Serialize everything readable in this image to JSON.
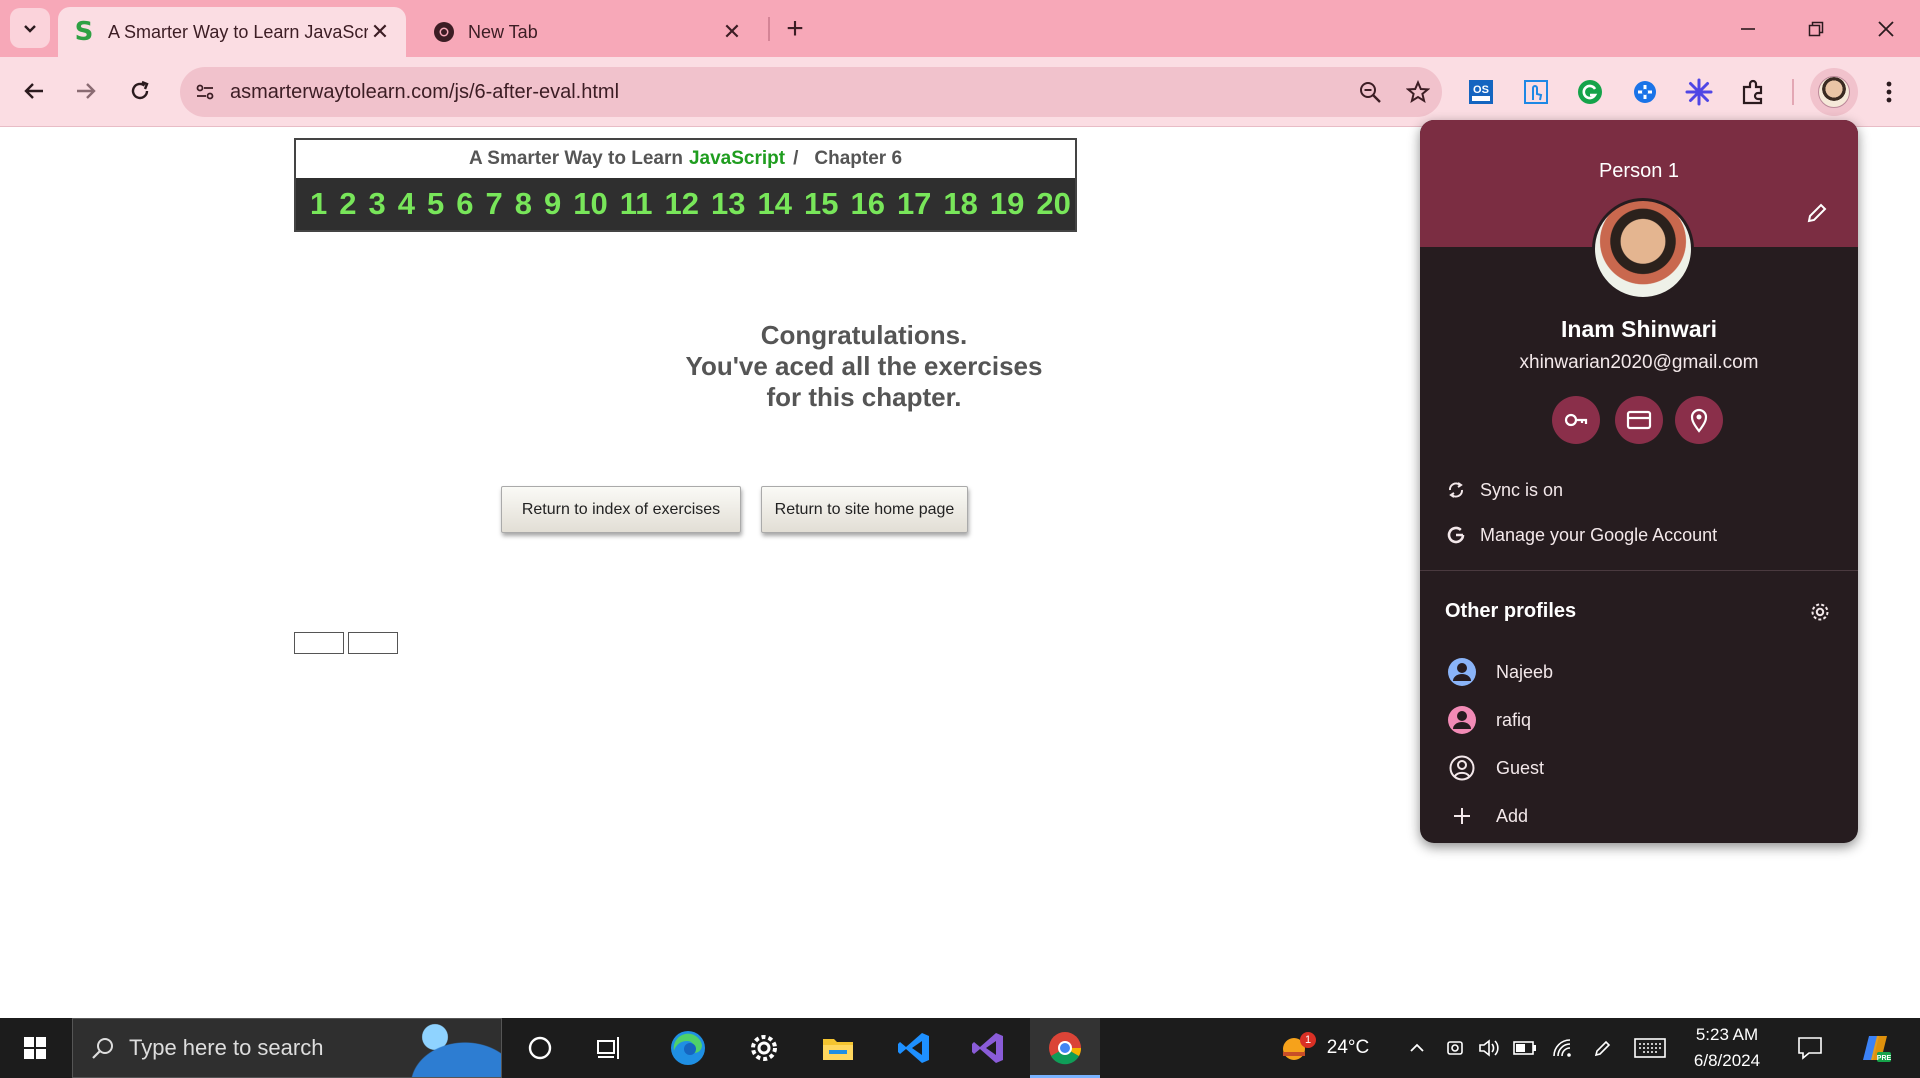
{
  "browser": {
    "tabs": [
      {
        "title": "A Smarter Way to Learn JavaScr",
        "favicon": "S",
        "active": true
      },
      {
        "title": "New Tab",
        "active": false
      }
    ],
    "url": "asmarterwaytolearn.com/js/6-after-eval.html",
    "extensions": [
      "os-addon-icon",
      "touch-icon",
      "grammarly-icon",
      "dashlane-icon",
      "sparkle-icon",
      "puzzle-icon"
    ]
  },
  "page": {
    "header": {
      "prefix": "A Smarter Way to Learn",
      "highlight": "JavaScript",
      "separator": "/",
      "chapter": "Chapter 6"
    },
    "chapter_numbers": [
      "1",
      "2",
      "3",
      "4",
      "5",
      "6",
      "7",
      "8",
      "9",
      "10",
      "11",
      "12",
      "13",
      "14",
      "15",
      "16",
      "17",
      "18",
      "19",
      "20"
    ],
    "congrats": {
      "line1": "Congratulations.",
      "line2": "You've aced all the exercises",
      "line3": "for this chapter."
    },
    "buttons": {
      "index": "Return to index of exercises",
      "home": "Return to site home page"
    }
  },
  "profile_menu": {
    "header": "Person 1",
    "name": "Inam Shinwari",
    "email": "xhinwarian2020@gmail.com",
    "sync": "Sync is on",
    "manage": "Manage your Google Account",
    "other_profiles_title": "Other profiles",
    "profiles": [
      {
        "name": "Najeeb",
        "color": "#8ab4f8"
      },
      {
        "name": "rafiq",
        "color": "#f28bb6"
      },
      {
        "name": "Guest"
      }
    ],
    "add": "Add",
    "colors": {
      "header": "#7b2d42",
      "body": "#261c1f",
      "round_button": "#8a2f4a"
    }
  },
  "taskbar": {
    "search_placeholder": "Type here to search",
    "temperature": "24°C",
    "weather_badge": "1",
    "time": "5:23 AM",
    "date": "6/8/2024"
  }
}
